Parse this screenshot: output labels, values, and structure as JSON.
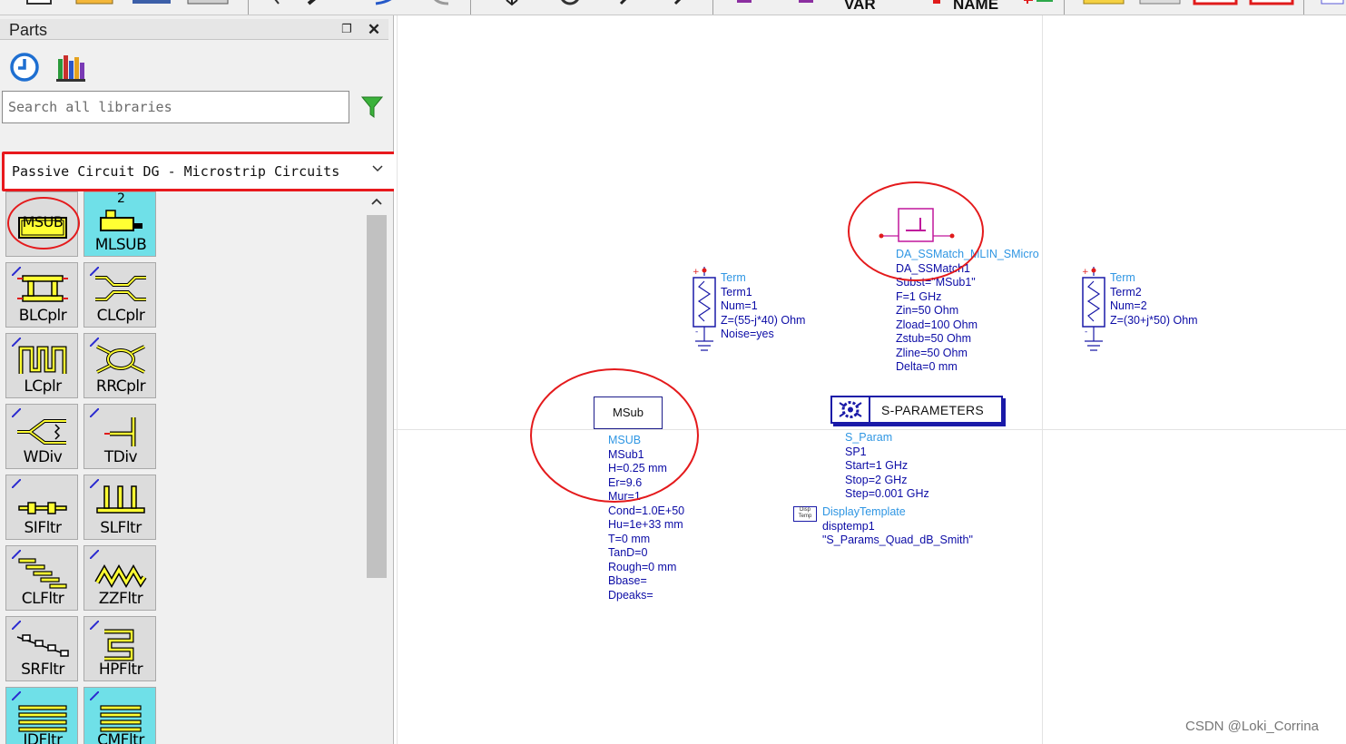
{
  "toolbar": {
    "var_label": "VAR",
    "name_label": "NAME"
  },
  "parts_panel": {
    "title": "Parts",
    "search": {
      "placeholder": "Search all libraries",
      "value": ""
    },
    "library_selected": "Passive Circuit DG - Microstrip Circuits",
    "items": [
      {
        "label": "MSUB",
        "icon": "msub-icon"
      },
      {
        "label": "MLSUB",
        "icon": "mlsub-icon"
      },
      {
        "label": "BLCplr",
        "icon": "blcplr-icon"
      },
      {
        "label": "CLCplr",
        "icon": "clcplr-icon"
      },
      {
        "label": "LCplr",
        "icon": "lcplr-icon"
      },
      {
        "label": "RRCplr",
        "icon": "rrcplr-icon"
      },
      {
        "label": "WDiv",
        "icon": "wdiv-icon"
      },
      {
        "label": "TDiv",
        "icon": "tdiv-icon"
      },
      {
        "label": "SIFltr",
        "icon": "sifltr-icon"
      },
      {
        "label": "SLFltr",
        "icon": "slfltr-icon"
      },
      {
        "label": "CLFltr",
        "icon": "clfltr-icon"
      },
      {
        "label": "ZZFltr",
        "icon": "zzfltr-icon"
      },
      {
        "label": "SRFltr",
        "icon": "srfltr-icon"
      },
      {
        "label": "HPFltr",
        "icon": "hpfltr-icon"
      },
      {
        "label": "IDFltr",
        "icon": "idfltr-icon"
      },
      {
        "label": "CMFltr",
        "icon": "cmfltr-icon"
      }
    ],
    "mlsub_badge": "2"
  },
  "schematic": {
    "term1": {
      "type": "Term",
      "lines": [
        "Term1",
        "Num=1",
        "Z=(55-j*40) Ohm",
        "Noise=yes"
      ]
    },
    "term2": {
      "type": "Term",
      "lines": [
        "Term2",
        "Num=2",
        "Z=(30+j*50) Ohm"
      ]
    },
    "ssmatch": {
      "type": "DA_SSMatch_MLIN_SMicro",
      "lines": [
        "DA_SSMatch1",
        "Subst=\"MSub1\"",
        "F=1 GHz",
        "Zin=50 Ohm",
        "Zload=100 Ohm",
        "Zstub=50 Ohm",
        "Zline=50 Ohm",
        "Delta=0 mm"
      ]
    },
    "msub": {
      "box_label": "MSub",
      "type": "MSUB",
      "lines": [
        "MSub1",
        "H=0.25 mm",
        "Er=9.6",
        "Mur=1",
        "Cond=1.0E+50",
        "Hu=1e+33 mm",
        "T=0 mm",
        "TanD=0",
        "Rough=0 mm",
        "Bbase=",
        "Dpeaks="
      ]
    },
    "sparam": {
      "box_label": "S-PARAMETERS",
      "type": "S_Param",
      "lines": [
        "SP1",
        "Start=1 GHz",
        "Stop=2 GHz",
        "Step=0.001 GHz"
      ]
    },
    "display_template": {
      "icon_text": "Disp Temp",
      "type": "DisplayTemplate",
      "lines": [
        "disptemp1",
        "\"S_Params_Quad_dB_Smith\""
      ]
    }
  },
  "watermark": "CSDN @Loki_Corrina",
  "colors": {
    "highlight_red": "#e8191d",
    "param_blue": "#2f96e3",
    "param_dark": "#0c0ca6",
    "component_magenta": "#c0179c"
  }
}
